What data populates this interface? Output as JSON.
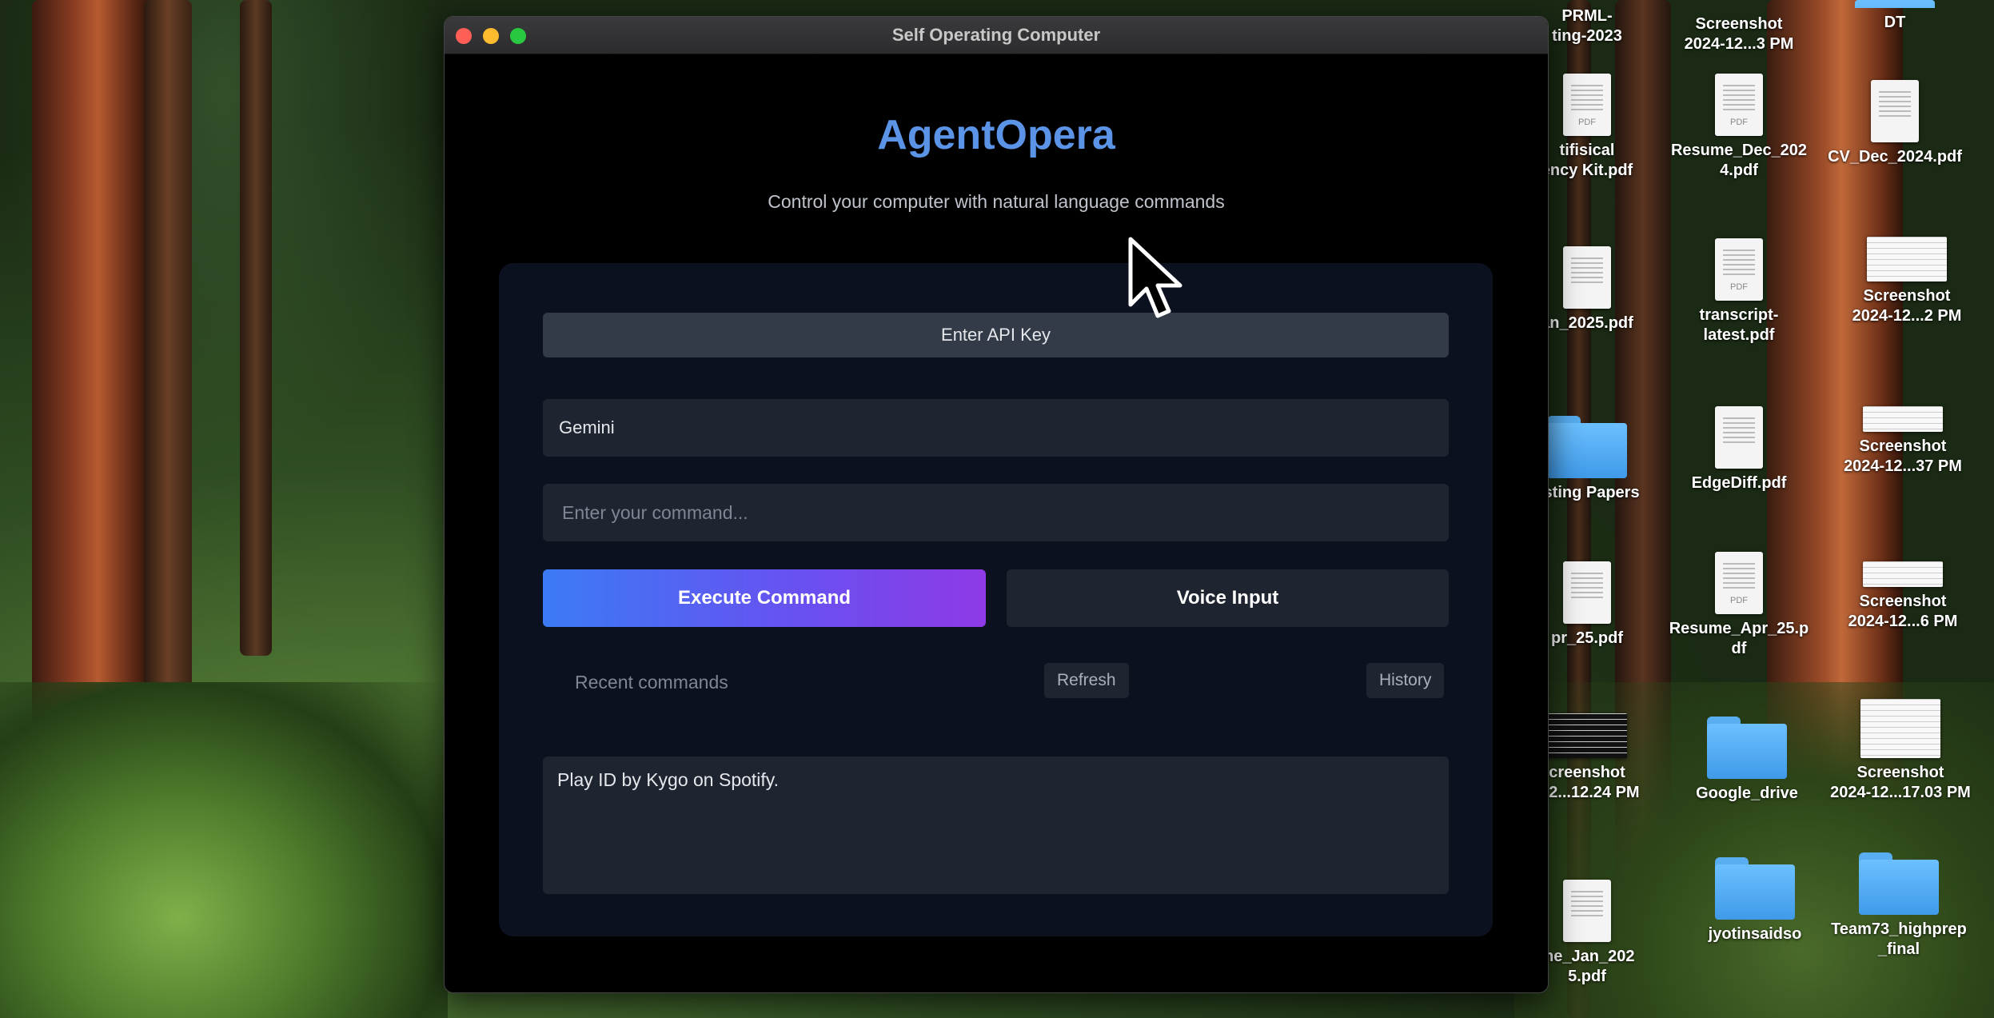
{
  "window": {
    "title": "Self Operating Computer"
  },
  "app": {
    "brand": "AgentOpera",
    "tagline": "Control your computer with natural language commands",
    "api_key_button": "Enter API Key",
    "model_select": "Gemini",
    "command_placeholder": "Enter your command...",
    "execute_button": "Execute Command",
    "voice_button": "Voice Input",
    "recent_label": "Recent commands",
    "refresh_button": "Refresh",
    "history_button": "History",
    "output_text": "Play ID by Kygo on Spotify."
  },
  "colors": {
    "brand": "#5b93e6",
    "execute_gradient_start": "#3b7bf5",
    "execute_gradient_end": "#8f3ae6",
    "panel": "#0c1120"
  },
  "desktop": {
    "col1": [
      {
        "line1": "PRML-",
        "line2": "ting-2023",
        "icon": "document-icon"
      },
      {
        "line1": "tifisical",
        "line2": "ency Kit.pdf",
        "icon": "pdf-document-icon"
      },
      {
        "line1": "an_2025.pdf",
        "line2": "",
        "icon": "pdf-document-icon"
      },
      {
        "line1": "esting Papers",
        "line2": "",
        "icon": "folder-icon"
      },
      {
        "line1": "pr_25.pdf",
        "line2": "",
        "icon": "pdf-document-icon"
      },
      {
        "line1": "creenshot",
        "line2": "-12...12.24 PM",
        "icon": "screenshot-icon"
      },
      {
        "line1": "me_Jan_202",
        "line2": "5.pdf",
        "icon": "pdf-document-icon"
      }
    ],
    "col2": [
      {
        "line1": "Screenshot",
        "line2": "2024-12...3 PM",
        "icon": "screenshot-icon"
      },
      {
        "line1": "Resume_Dec_202",
        "line2": "4.pdf",
        "icon": "pdf-document-icon"
      },
      {
        "line1": "transcript-",
        "line2": "latest.pdf",
        "icon": "pdf-document-icon"
      },
      {
        "line1": "EdgeDiff.pdf",
        "line2": "",
        "icon": "pdf-document-icon"
      },
      {
        "line1": "Resume_Apr_25.p",
        "line2": "df",
        "icon": "pdf-document-icon"
      },
      {
        "line1": "Google_drive",
        "line2": "",
        "icon": "folder-icon"
      },
      {
        "line1": "jyotinsaidso",
        "line2": "",
        "icon": "folder-icon"
      }
    ],
    "col3": [
      {
        "line1": "DT",
        "line2": "",
        "icon": "folder-icon"
      },
      {
        "line1": "CV_Dec_2024.pdf",
        "line2": "",
        "icon": "document-icon"
      },
      {
        "line1": "Screenshot",
        "line2": "2024-12...2 PM",
        "icon": "screenshot-icon"
      },
      {
        "line1": "Screenshot",
        "line2": "2024-12...37 PM",
        "icon": "screenshot-icon"
      },
      {
        "line1": "Screenshot",
        "line2": "2024-12...6 PM",
        "icon": "screenshot-icon"
      },
      {
        "line1": "Screenshot",
        "line2": "2024-12...17.03 PM",
        "icon": "screenshot-icon"
      },
      {
        "line1": "Team73_highprep",
        "line2": "_final",
        "icon": "folder-icon"
      }
    ]
  }
}
